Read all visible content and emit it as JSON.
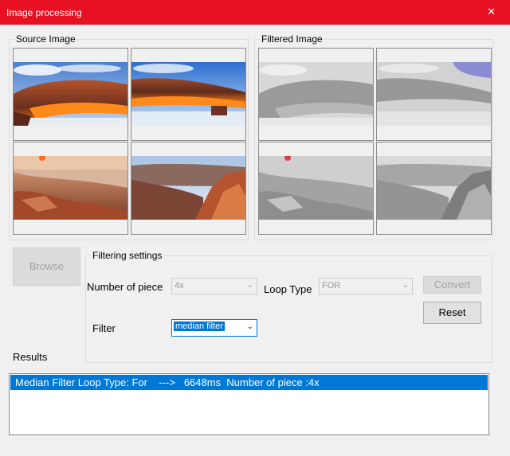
{
  "window": {
    "title": "Image processing",
    "close_glyph": "✕"
  },
  "source_group": {
    "label": "Source Image"
  },
  "filtered_group": {
    "label": "Filtered Image"
  },
  "settings_group": {
    "label": "Filtering settings"
  },
  "buttons": {
    "browse": "Browse",
    "convert": "Convert",
    "reset": "Reset"
  },
  "fields": {
    "pieces_label": "Number of piece",
    "pieces_value": "4x",
    "loop_label": "Loop Type",
    "loop_value": "FOR",
    "filter_label": "Filter",
    "filter_value": "median filter"
  },
  "results": {
    "label": "Results",
    "items": [
      "Median Filter Loop Type: For    --->   6648ms  Number of piece :4x"
    ]
  },
  "colors": {
    "titlebar": "#e81123",
    "selection": "#0078d7"
  }
}
